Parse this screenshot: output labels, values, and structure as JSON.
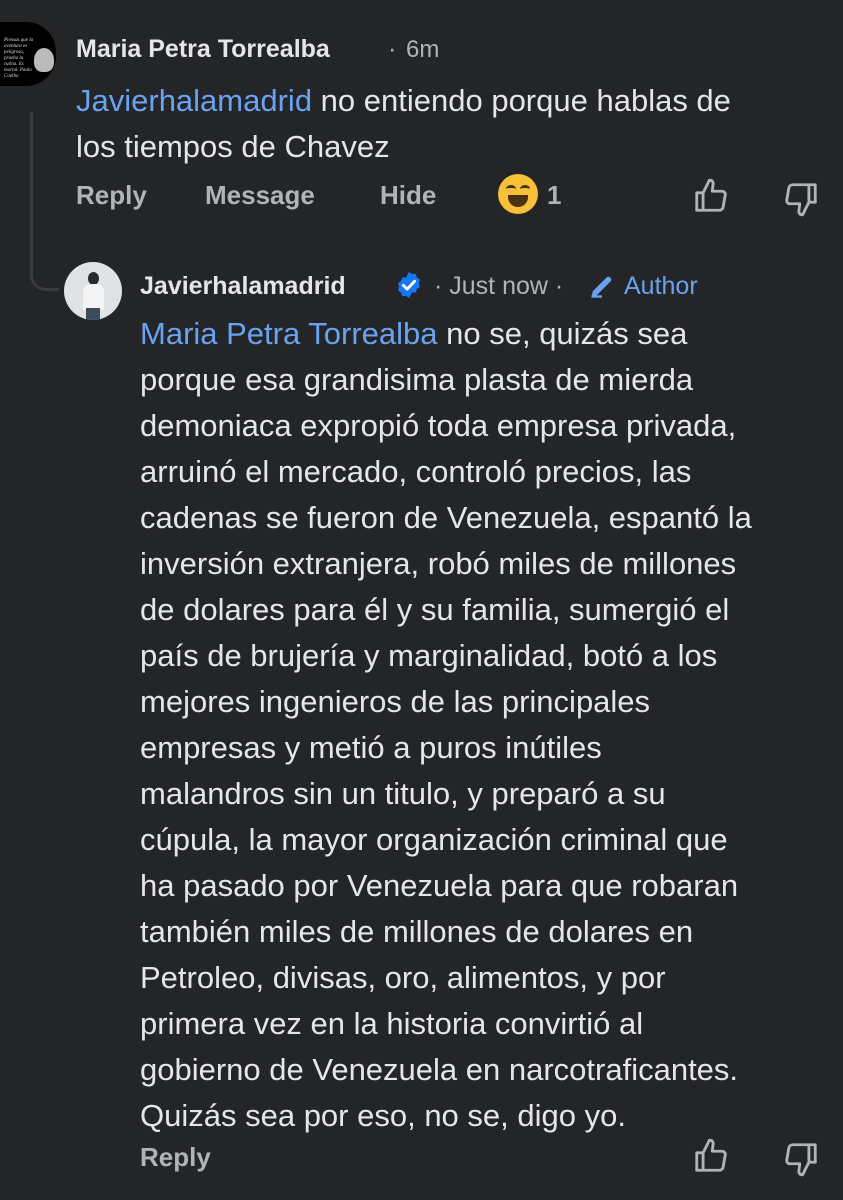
{
  "comment1": {
    "author": "Maria Petra Torrealba",
    "separator": "·",
    "time": "6m",
    "mention": "Javierhalamadrid",
    "text_line1": " no entiendo porque hablas de",
    "text_line2": "los tiempos de Chavez",
    "actions": {
      "reply": "Reply",
      "message": "Message",
      "hide": "Hide",
      "reaction_icon": "grinning-squinting-face",
      "reaction_count": "1"
    }
  },
  "comment2": {
    "author": "Javierhalamadrid",
    "verified_icon": "verified-badge-icon",
    "meta": "· Just now ·",
    "author_badge_icon": "pencil-icon",
    "author_label": "Author",
    "mention": "Maria Petra Torrealba",
    "lines": [
      " no se, quizás sea",
      "porque esa grandisima plasta de mierda",
      "demoniaca expropió toda empresa privada,",
      "arruinó el mercado, controló precios, las",
      "cadenas se fueron de Venezuela, espantó la",
      "inversión extranjera, robó miles de millones",
      "de dolares para él y su familia, sumergió el",
      "país de brujería y marginalidad, botó a los",
      "mejores ingenieros de las principales",
      "empresas y metió a puros inútiles",
      "malandros sin un titulo, y preparó a su",
      "cúpula, la mayor organización criminal que",
      "ha pasado por Venezuela para que robaran",
      "también miles de millones de dolares en",
      "Petroleo, divisas, oro, alimentos, y por",
      "primera vez en la historia convirtió al",
      "gobierno de Venezuela en narcotraficantes.",
      "Quizás sea por eso, no se, digo yo."
    ],
    "actions": {
      "reply": "Reply"
    }
  },
  "avatar_quote": "Piensas que la aventura es peligrosa, prueba la rutina. Es mortal. Paulo Coelho",
  "colors": {
    "background": "#242526",
    "text": "#e4e6eb",
    "muted": "#b0b3b8",
    "link": "#6aa2f2",
    "verified": "#1877f2"
  }
}
